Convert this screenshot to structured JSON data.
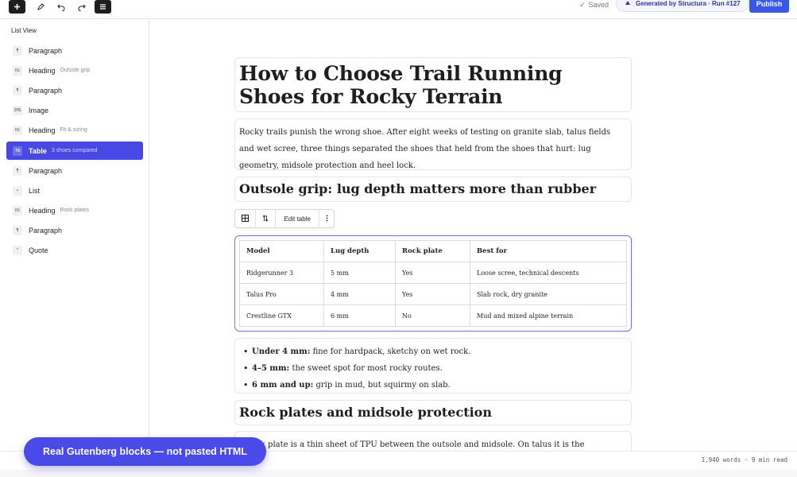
{
  "toolbar": {
    "saved_label": "Saved",
    "generated_label": "Generated by Structura · Run #127",
    "publish_label": "Publish",
    "icons": [
      "plus-icon",
      "pencil-icon",
      "undo-icon",
      "redo-icon",
      "list-view-icon"
    ]
  },
  "sidebar": {
    "title": "List View",
    "items": [
      {
        "badge": "¶",
        "label": "Paragraph",
        "sub": ""
      },
      {
        "badge": "H2",
        "label": "Heading",
        "sub": "Outsole grip"
      },
      {
        "badge": "¶",
        "label": "Paragraph",
        "sub": ""
      },
      {
        "badge": "IMG",
        "label": "Image",
        "sub": ""
      },
      {
        "badge": "H2",
        "label": "Heading",
        "sub": "Fit & sizing"
      },
      {
        "badge": "TB",
        "label": "Table",
        "sub": "3 shoes compared",
        "active": true
      },
      {
        "badge": "¶",
        "label": "Paragraph",
        "sub": ""
      },
      {
        "badge": "•",
        "label": "List",
        "sub": ""
      },
      {
        "badge": "H2",
        "label": "Heading",
        "sub": "Rock plates"
      },
      {
        "badge": "¶",
        "label": "Paragraph",
        "sub": ""
      },
      {
        "badge": "“",
        "label": "Quote",
        "sub": ""
      }
    ]
  },
  "editor": {
    "h1": "How to Choose Trail Running Shoes for Rocky Terrain",
    "intro": "Rocky trails punish the wrong shoe. After eight weeks of testing on granite slab, talus fields and wet scree, three things separated the shoes that held from the shoes that hurt: lug geometry, midsole protection and heel lock.",
    "h2_grip": "Outsole grip: lug depth matters more than rubber",
    "table_toolbar": {
      "edit_label": "Edit table"
    },
    "table": {
      "headers": [
        "Model",
        "Lug depth",
        "Rock plate",
        "Best for"
      ],
      "rows": [
        [
          "Ridgerunner 3",
          "5 mm",
          "Yes",
          "Loose scree, technical descents"
        ],
        [
          "Talus Pro",
          "4 mm",
          "Yes",
          "Slab rock, dry granite"
        ],
        [
          "Crestline GTX",
          "6 mm",
          "No",
          "Mud and mixed alpine terrain"
        ]
      ]
    },
    "list": [
      {
        "bold": "Under 4 mm:",
        "text": " fine for hardpack, sketchy on wet rock."
      },
      {
        "bold": "4–5 mm:",
        "text": " the sweet spot for most rocky routes."
      },
      {
        "bold": "6 mm and up:",
        "text": " grip in mud, but squirmy on slab."
      }
    ],
    "h2_plates": "Rock plates and midsole protection",
    "p2": "A rock plate is a thin sheet of TPU between the outsole and midsole. On talus it is the difference"
  },
  "status": {
    "word_count": "1,940 words · 9 min read"
  },
  "banner": {
    "text": "Real Gutenberg blocks — not pasted HTML"
  }
}
